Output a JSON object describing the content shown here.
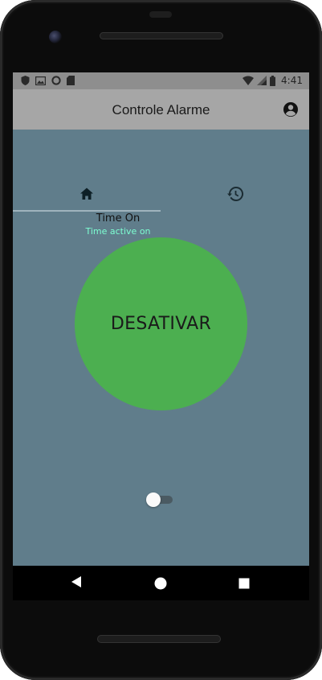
{
  "status_bar": {
    "time": "4:41",
    "left_icons": [
      "shield-icon",
      "image-icon",
      "circle-icon",
      "sd-card-icon"
    ],
    "right_icons": [
      "wifi-icon",
      "signal-icon",
      "battery-icon"
    ]
  },
  "app_bar": {
    "title": "Controle Alarme",
    "action_icon": "account-circle-icon"
  },
  "tabs": [
    {
      "icon": "home-icon",
      "selected": true
    },
    {
      "icon": "history-icon",
      "selected": false
    }
  ],
  "alarm": {
    "status_title": "Time On",
    "status_subtitle": "Time active on",
    "button_label": "DESATIVAR",
    "switch_on": false
  },
  "colors": {
    "content_bg": "#607d8b",
    "app_bar_bg": "#a6a6a6",
    "status_bar_bg": "#8e8e8e",
    "button_green": "#4caf50",
    "subtitle_accent": "#7dffd2"
  },
  "nav_bar": {
    "icons": [
      "back-icon",
      "home-circle-icon",
      "recents-icon"
    ]
  }
}
